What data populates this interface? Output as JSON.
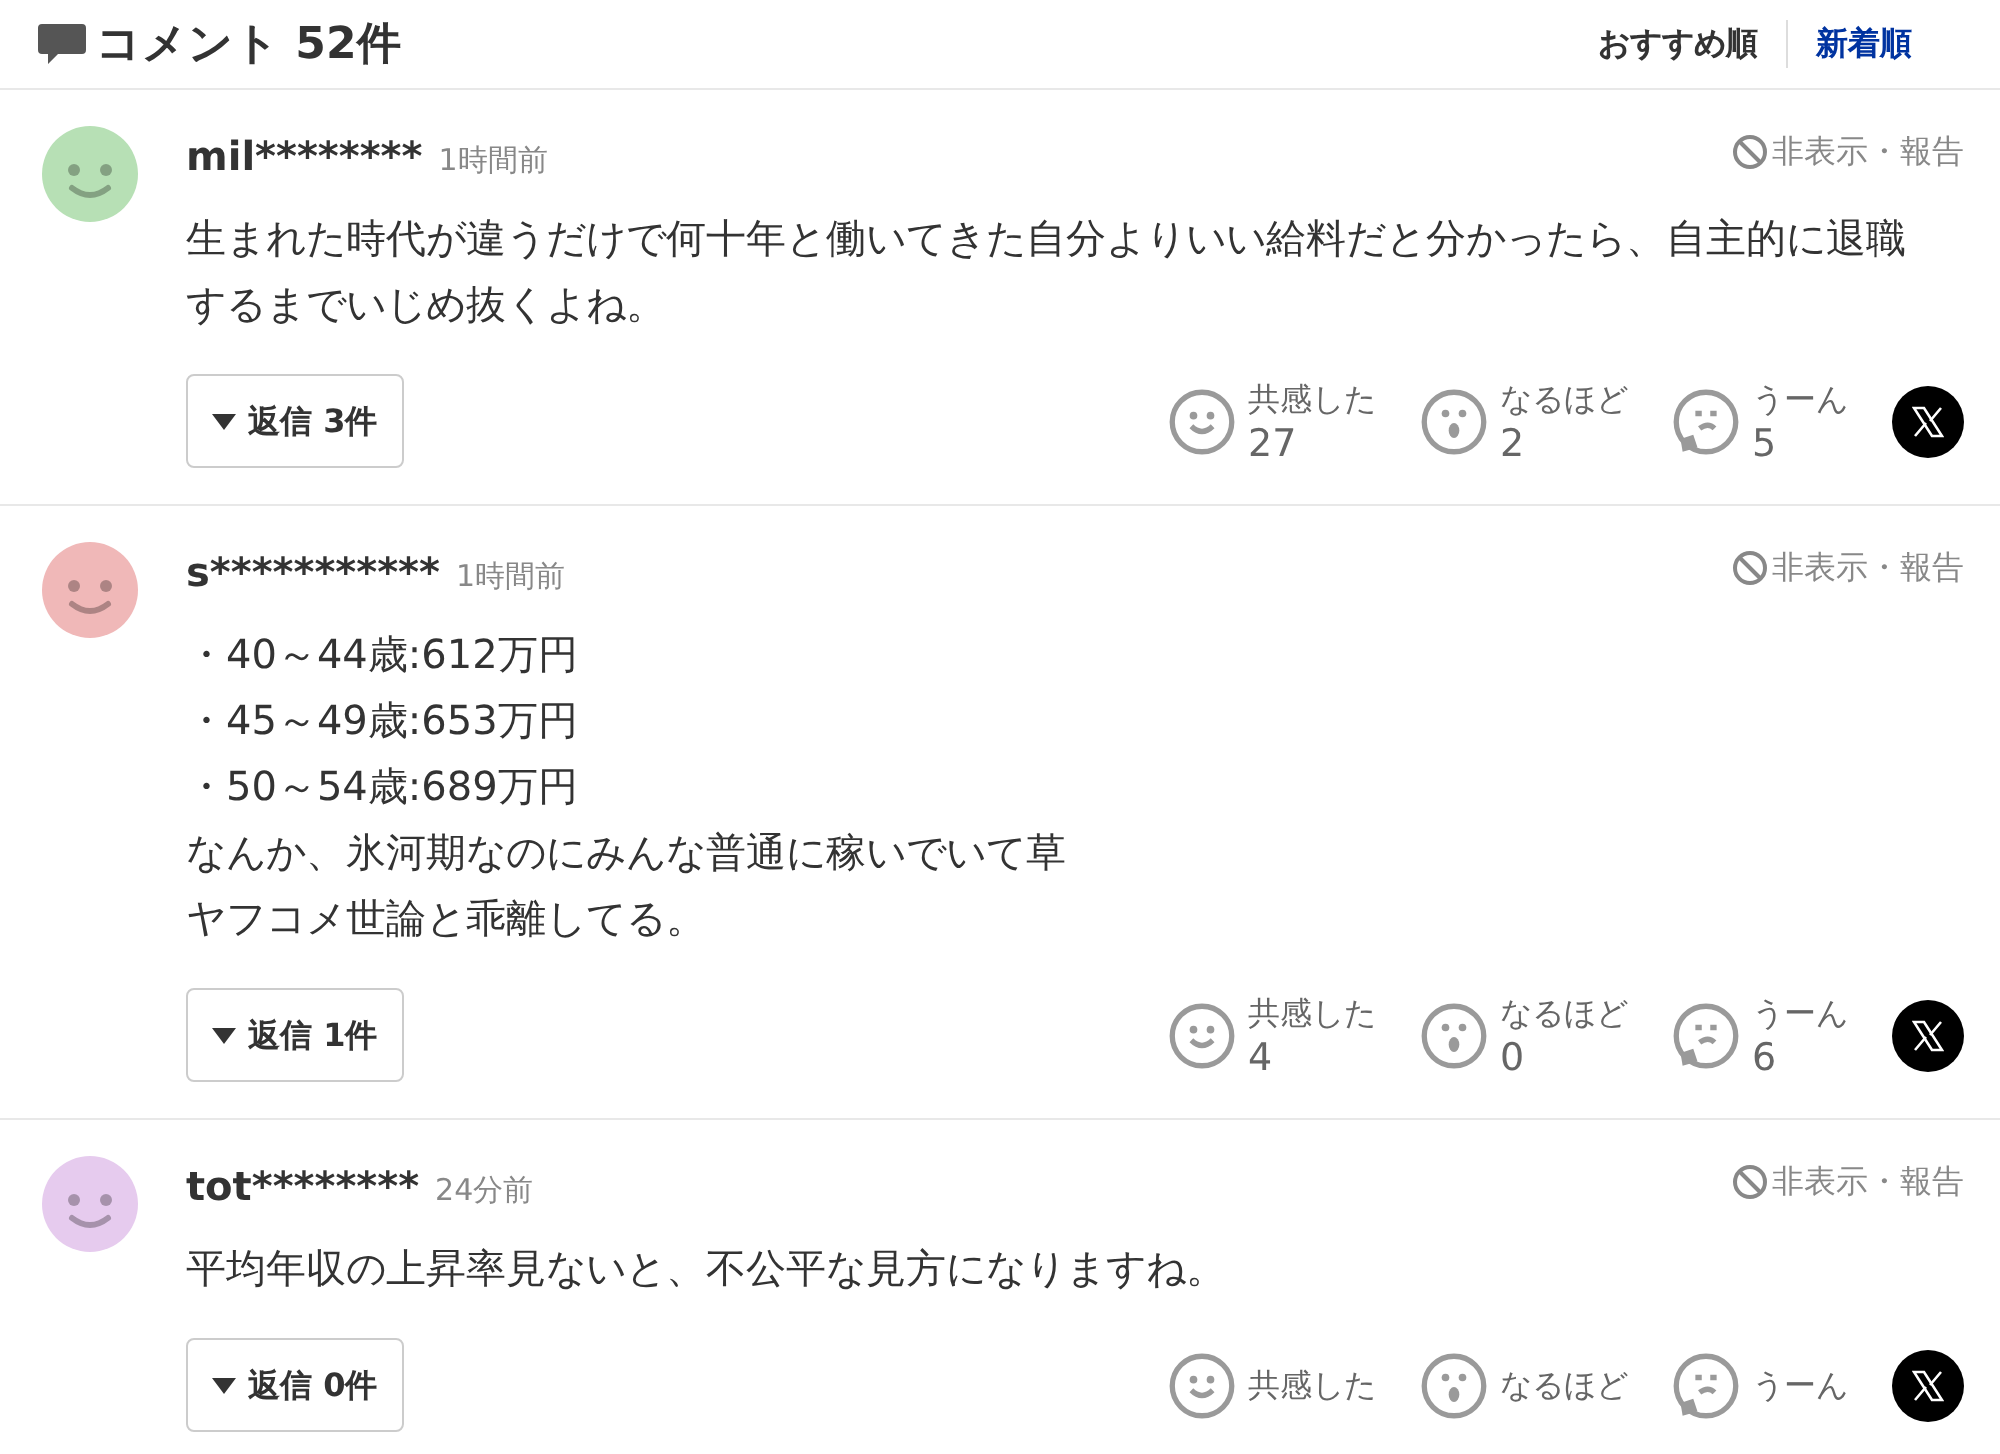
{
  "header": {
    "title": "コメント 52件",
    "sort_options": [
      {
        "label": "おすすめ順",
        "selected": false
      },
      {
        "label": "新着順",
        "selected": true
      }
    ]
  },
  "comments": [
    {
      "user": "mil********",
      "time": "1時間前",
      "color": "#b7e0b5",
      "hide_report": "非表示・報告",
      "body": [
        "生まれた時代が違うだけで何十年と働いてきた自分よりいい給料だと分かったら、自主的に退職するまでいじめ抜くよね。"
      ],
      "replies": "返信 3件",
      "reactions": [
        {
          "kind": "smile",
          "label": "共感した",
          "count": "27"
        },
        {
          "kind": "surprise",
          "label": "なるほど",
          "count": "2"
        },
        {
          "kind": "think",
          "label": "うーん",
          "count": "5"
        }
      ]
    },
    {
      "user": "s***********",
      "time": "1時間前",
      "color": "#f0b8b8",
      "hide_report": "非表示・報告",
      "body": [
        "・40～44歳:612万円",
        "・45～49歳:653万円",
        "・50～54歳:689万円",
        "なんか、氷河期なのにみんな普通に稼いでいて草",
        "ヤフコメ世論と乖離してる。"
      ],
      "replies": "返信 1件",
      "reactions": [
        {
          "kind": "smile",
          "label": "共感した",
          "count": "4"
        },
        {
          "kind": "surprise",
          "label": "なるほど",
          "count": "0"
        },
        {
          "kind": "think",
          "label": "うーん",
          "count": "6"
        }
      ]
    },
    {
      "user": "tot********",
      "time": "24分前",
      "color": "#e6cbee",
      "hide_report": "非表示・報告",
      "body": [
        "平均年収の上昇率見ないと、不公平な見方になりますね。"
      ],
      "replies": "返信 0件",
      "reactions": [
        {
          "kind": "smile",
          "label": "共感した"
        },
        {
          "kind": "surprise",
          "label": "なるほど"
        },
        {
          "kind": "think",
          "label": "うーん"
        }
      ]
    }
  ]
}
